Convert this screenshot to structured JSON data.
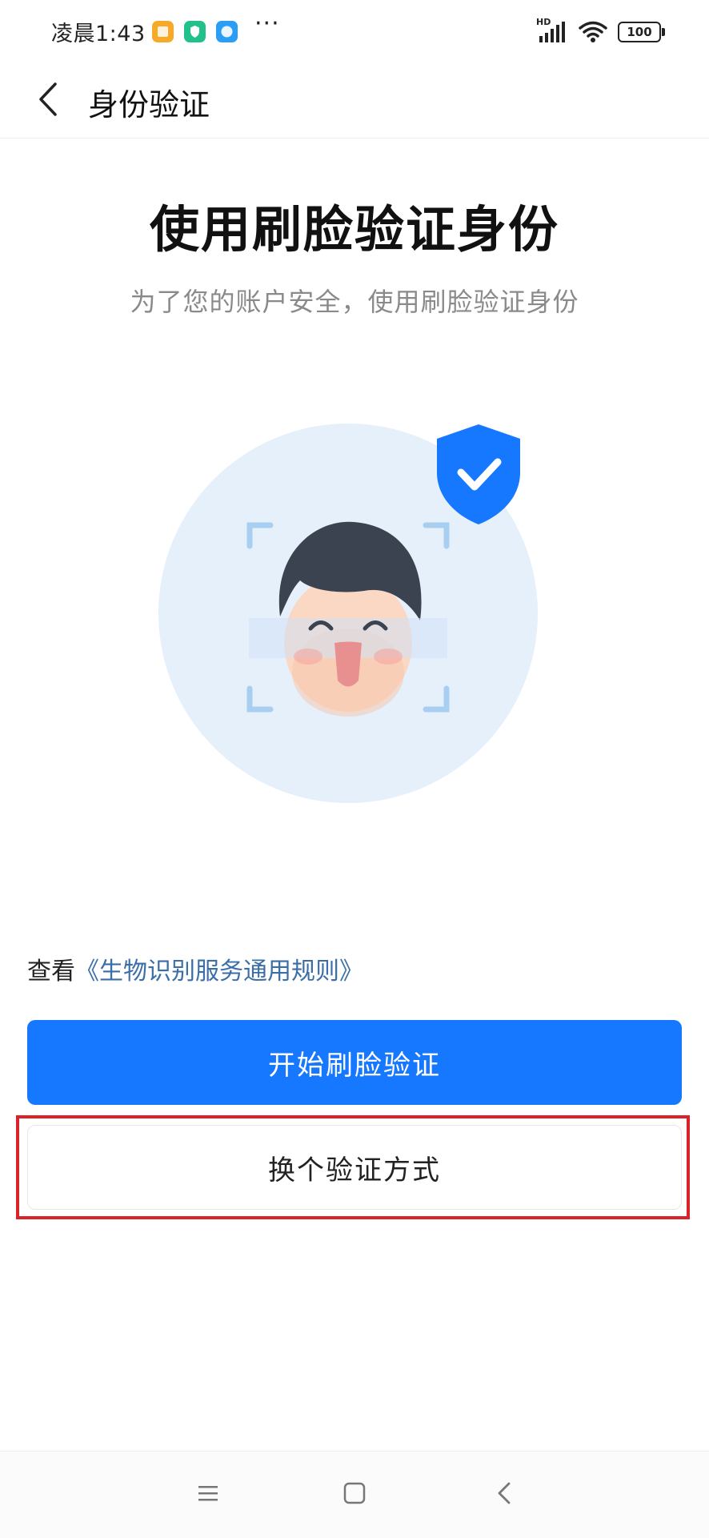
{
  "status_bar": {
    "time": "凌晨1:43",
    "more_indicator": "···",
    "network_label": "HD",
    "battery_level": "100",
    "app_icons": [
      {
        "name": "notes-app-icon",
        "color": "#f7a928"
      },
      {
        "name": "security-app-icon",
        "color": "#22c08a"
      },
      {
        "name": "browser-app-icon",
        "color": "#2a9df4"
      }
    ]
  },
  "header": {
    "back_icon": "chevron-left-icon",
    "title": "身份验证"
  },
  "main": {
    "title": "使用刷脸验证身份",
    "subtitle": "为了您的账户安全，使用刷脸验证身份"
  },
  "illustration": {
    "icon": "face-scan-illustration",
    "badge_icon": "shield-check-icon",
    "colors": {
      "circle": "#e6f0fb",
      "corners": "#a8cff2",
      "shield": "#1677ff",
      "hair": "#3b4250",
      "skin": "#fbd8c4"
    }
  },
  "agreement": {
    "prefix": "查看",
    "link_text": "《生物识别服务通用规则》"
  },
  "buttons": {
    "primary_label": "开始刷脸验证",
    "secondary_label": "换个验证方式"
  },
  "nav_bar": {
    "menu_icon": "menu-icon",
    "home_icon": "home-square-icon",
    "back_icon": "back-triangle-icon"
  },
  "colors": {
    "primary": "#1677ff",
    "highlight": "#d9222a",
    "link": "#3a6ea8"
  }
}
